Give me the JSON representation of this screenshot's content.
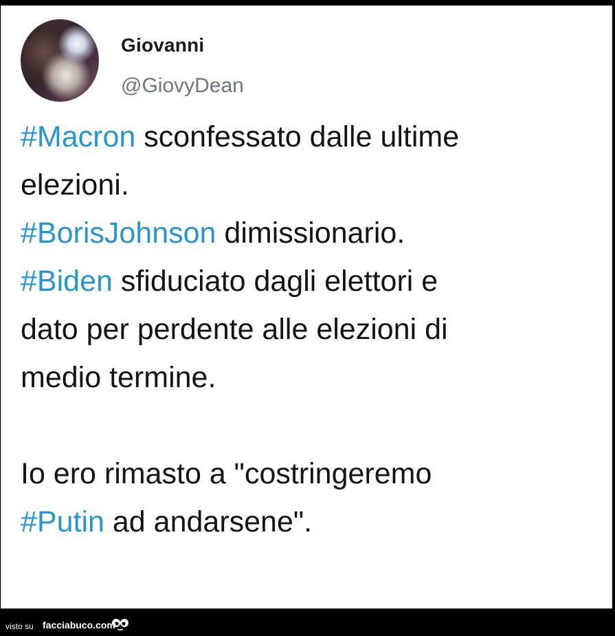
{
  "tweet": {
    "user_name": "Giovanni",
    "handle": "@GiovyDean",
    "lines": [
      {
        "hashtag": "#Macron",
        "text": " sconfessato dalle ultime"
      },
      {
        "hashtag": "",
        "text": "elezioni."
      },
      {
        "hashtag": "#BorisJohnson",
        "text": " dimissionario."
      },
      {
        "hashtag": "#Biden",
        "text": " sfiduciato dagli elettori e"
      },
      {
        "hashtag": "",
        "text": "dato per perdente alle elezioni di"
      },
      {
        "hashtag": "",
        "text": "medio termine."
      },
      {
        "hashtag": "",
        "text": ""
      },
      {
        "hashtag": "",
        "text": "Io ero rimasto a \"costringeremo"
      },
      {
        "hashtag": "#Putin",
        "text": " ad andarsene\"."
      }
    ],
    "hashtag_color": "#2a95c9"
  },
  "footer": {
    "seen_on": "visto su",
    "site": "facciabuco.com",
    "logo_icon": "eyes-icon"
  }
}
